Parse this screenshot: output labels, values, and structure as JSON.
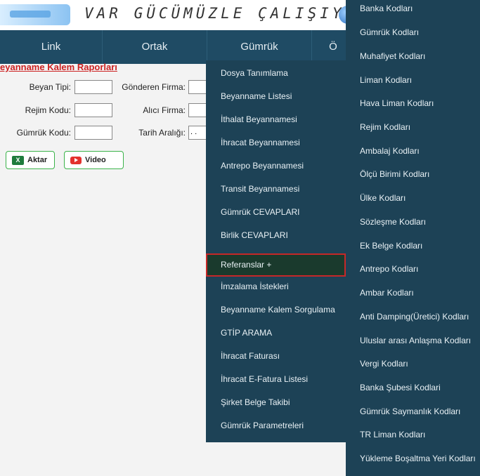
{
  "banner": {
    "slogan": "VAR GÜCÜMÜZLE ÇALIŞIYORUZ"
  },
  "navbar": {
    "items": [
      "Link",
      "Ortak",
      "Gümrük",
      "Ö"
    ]
  },
  "report": {
    "title": "eyanname Kalem Raporları",
    "fields": {
      "beyan_tipi": "Beyan Tipi:",
      "gonderen_firma": "Gönderen Firma:",
      "rejim_kodu": "Rejim Kodu:",
      "alici_firma": "Alıcı Firma:",
      "gumruk_kodu": "Gümrük Kodu:",
      "tarih_araligi": "Tarih Aralığı:",
      "date_value": " . ."
    },
    "buttons": {
      "aktar": "Aktar",
      "video": "Video"
    }
  },
  "gumruk_menu": {
    "items": [
      "Dosya Tanımlama",
      "Beyanname Listesi",
      "İthalat Beyannamesi",
      "İhracat Beyannamesi",
      "Antrepo Beyannamesi",
      "Transit Beyannamesi",
      "Gümrük CEVAPLARI",
      "Birlik CEVAPLARI",
      "Referanslar +",
      "İmzalama İstekleri",
      "Beyanname Kalem Sorgulama",
      "GTİP ARAMA",
      "İhracat Faturası",
      "İhracat E-Fatura Listesi",
      "Şirket Belge Takibi",
      "Gümrük Parametreleri"
    ],
    "active": "Referanslar +"
  },
  "referanslar_submenu": {
    "items": [
      "Banka Kodları",
      "Gümrük Kodları",
      "Muhafiyet Kodları",
      "Liman Kodları",
      "Hava Liman Kodları",
      "Rejim Kodları",
      "Ambalaj Kodları",
      "Ölçü Birimi Kodları",
      "Ülke Kodları",
      "Sözleşme Kodları",
      "Ek Belge Kodları",
      "Antrepo Kodları",
      "Ambar Kodları",
      "Anti Damping(Üretici) Kodları",
      "Uluslar arası Anlaşma Kodları",
      "Vergi Kodları",
      "Banka Şubesi Kodlari",
      "Gümrük Saymanlık Kodları",
      "TR Liman Kodları",
      "Yükleme Boşaltma Yeri Kodları"
    ]
  },
  "colors": {
    "navbar": "#1f4b64",
    "menu": "#1d4256",
    "highlight_border": "#c62828",
    "report_title": "#cc2222"
  },
  "icons": [
    "excel-icon",
    "video-icon",
    "globe-icon",
    "logo"
  ]
}
